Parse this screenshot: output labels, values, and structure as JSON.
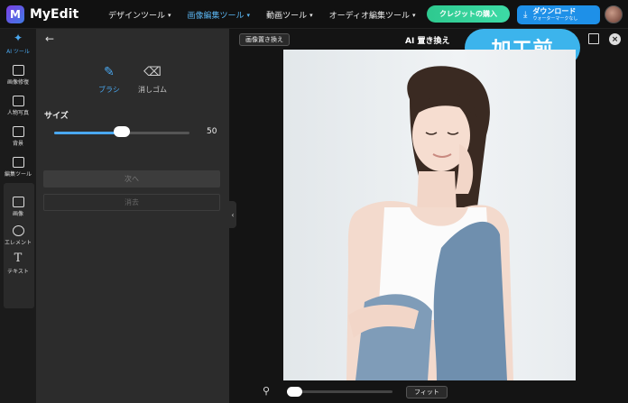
{
  "app": {
    "name": "MyEdit",
    "logo_letter": "M"
  },
  "nav": {
    "items": [
      {
        "label": "デザインツール",
        "active": false
      },
      {
        "label": "画像編集ツール",
        "active": true
      },
      {
        "label": "動画ツール",
        "active": false
      },
      {
        "label": "オーディオ編集ツール",
        "active": false
      }
    ]
  },
  "header": {
    "credit_button": "クレジットの購入",
    "download_button": "ダウンロード",
    "download_sub": "ウォーターマークなし"
  },
  "rail": {
    "items": [
      {
        "label": "AI ツール",
        "icon": "magic-wand-icon",
        "glyph": "✦",
        "active": true
      },
      {
        "label": "画像修復",
        "icon": "image-repair-icon",
        "glyph": "▦",
        "active": false
      },
      {
        "label": "人物写真",
        "icon": "portrait-icon",
        "glyph": "☺",
        "active": false
      },
      {
        "label": "背景",
        "icon": "background-icon",
        "glyph": "▨",
        "active": false
      },
      {
        "label": "編集ツール",
        "icon": "edit-tools-icon",
        "glyph": "⧉",
        "active": false
      },
      {
        "label": "画像",
        "icon": "image-icon",
        "glyph": "▣",
        "active": false
      },
      {
        "label": "エレメント",
        "icon": "elements-icon",
        "glyph": "◇",
        "active": false
      },
      {
        "label": "テキスト",
        "icon": "text-icon",
        "glyph": "T",
        "active": false
      }
    ]
  },
  "panel": {
    "brush_label": "ブラシ",
    "eraser_label": "消しゴム",
    "size_label": "サイズ",
    "size_value": "50",
    "size_fraction": 0.5,
    "next_button": "次へ",
    "clear_button": "消去"
  },
  "canvas": {
    "replace_button": "画像置き換え",
    "title": "AI 置き換え",
    "badge": "加工前",
    "fit_button": "フィット",
    "zoom_fraction": 0.0
  },
  "colors": {
    "accent": "#4aa8f0",
    "credit": "#2ec98f",
    "download": "#1e90e8",
    "badge": "#3cb4ec"
  }
}
